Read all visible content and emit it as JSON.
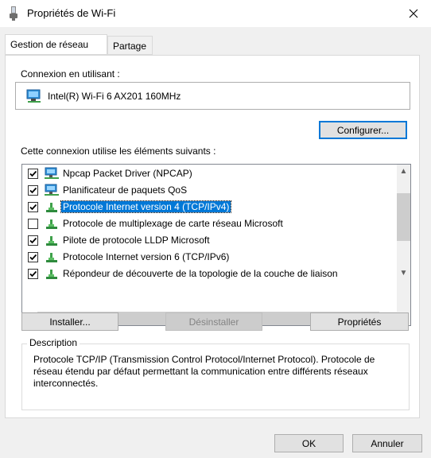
{
  "window": {
    "title": "Propriétés de Wi-Fi"
  },
  "tabs": [
    {
      "label": "Gestion de réseau",
      "active": true
    },
    {
      "label": "Partage",
      "active": false
    }
  ],
  "connection": {
    "label": "Connexion en utilisant :",
    "adapter": "Intel(R) Wi-Fi 6 AX201 160MHz",
    "configure_button": "Configurer..."
  },
  "components": {
    "label": "Cette connexion utilise les éléments suivants :",
    "items": [
      {
        "label": "Npcap Packet Driver (NPCAP)",
        "checked": true,
        "icon": "network-client-icon"
      },
      {
        "label": "Planificateur de paquets QoS",
        "checked": true,
        "icon": "network-client-icon"
      },
      {
        "label": "Protocole Internet version 4 (TCP/IPv4)",
        "checked": true,
        "icon": "protocol-icon",
        "selected": true
      },
      {
        "label": "Protocole de multiplexage de carte réseau Microsoft",
        "checked": false,
        "icon": "protocol-icon"
      },
      {
        "label": "Pilote de protocole LLDP Microsoft",
        "checked": true,
        "icon": "protocol-icon"
      },
      {
        "label": "Protocole Internet version 6 (TCP/IPv6)",
        "checked": true,
        "icon": "protocol-icon"
      },
      {
        "label": "Répondeur de découverte de la topologie de la couche de liaison",
        "checked": true,
        "icon": "protocol-icon"
      }
    ]
  },
  "buttons": {
    "install": "Installer...",
    "uninstall": "Désinstaller",
    "properties": "Propriétés",
    "ok": "OK",
    "cancel": "Annuler"
  },
  "description": {
    "title": "Description",
    "text": "Protocole TCP/IP (Transmission Control Protocol/Internet Protocol). Protocole de réseau étendu par défaut permettant la communication entre différents réseaux interconnectés."
  },
  "colors": {
    "selection": "#0078d7",
    "focus_border": "#0078d7",
    "dialog_bg": "#f0f0f0"
  }
}
